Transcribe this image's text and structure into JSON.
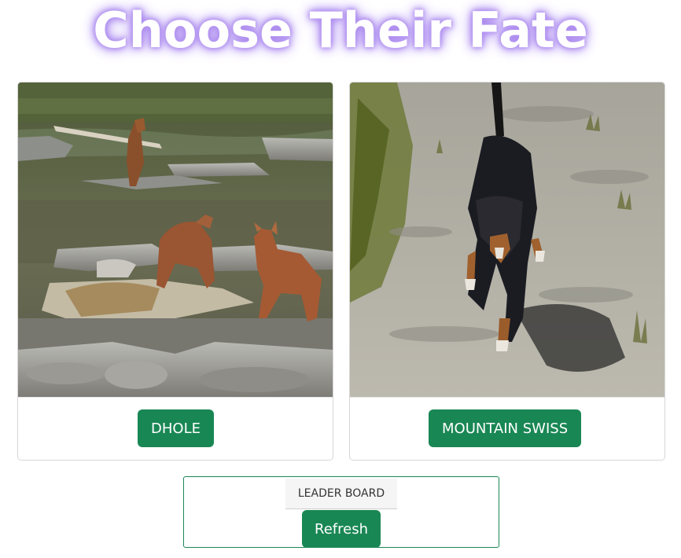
{
  "header": {
    "title": "Choose Their Fate"
  },
  "cards": [
    {
      "image_subject": "dhole",
      "button_label": "DHOLE"
    },
    {
      "image_subject": "mountain-swiss-dog",
      "button_label": "MOUNTAIN SWISS"
    }
  ],
  "leaderboard": {
    "label": "LEADER BOARD",
    "refresh_label": "Refresh"
  },
  "colors": {
    "accent": "#198754",
    "title_glow": "#a885ef"
  }
}
